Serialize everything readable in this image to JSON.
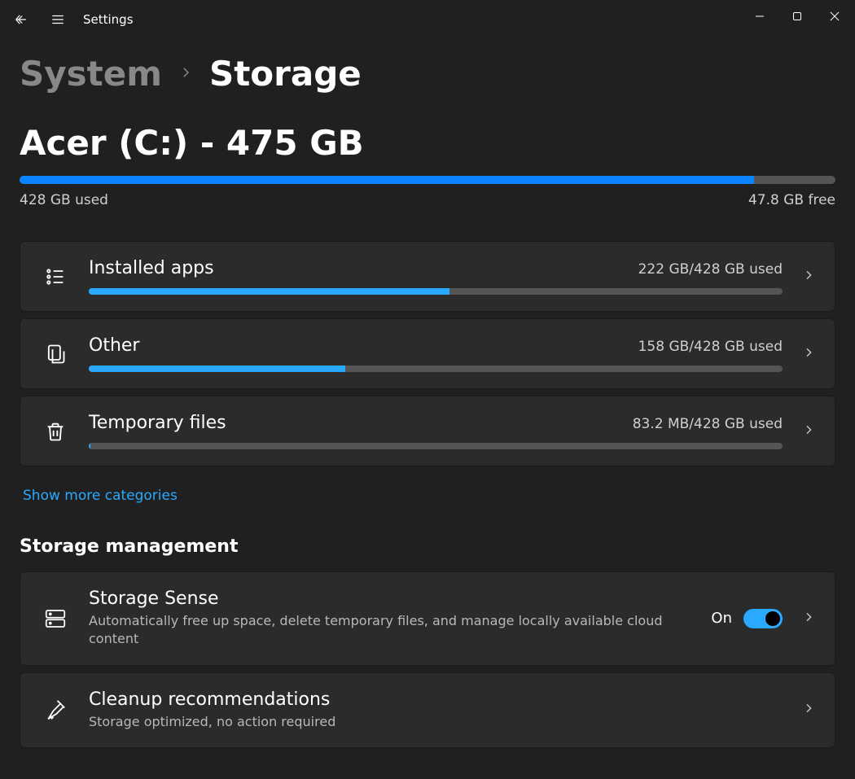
{
  "titlebar": {
    "app_name": "Settings"
  },
  "breadcrumb": {
    "parent": "System",
    "current": "Storage"
  },
  "drive": {
    "title": "Acer (C:) - 475 GB",
    "used_label": "428 GB used",
    "free_label": "47.8 GB free",
    "fill_percent": 90
  },
  "categories": [
    {
      "name": "Installed apps",
      "usage": "222 GB/428 GB used",
      "fill_percent": 52,
      "icon": "apps-list-icon"
    },
    {
      "name": "Other",
      "usage": "158 GB/428 GB used",
      "fill_percent": 37,
      "icon": "document-stack-icon"
    },
    {
      "name": "Temporary files",
      "usage": "83.2 MB/428 GB used",
      "fill_percent": 0.2,
      "icon": "trash-icon"
    }
  ],
  "show_more_label": "Show more categories",
  "storage_mgmt_heading": "Storage management",
  "storage_sense": {
    "title": "Storage Sense",
    "desc": "Automatically free up space, delete temporary files, and manage locally available cloud content",
    "toggle_label": "On",
    "toggle_on": true
  },
  "cleanup": {
    "title": "Cleanup recommendations",
    "desc": "Storage optimized, no action required"
  },
  "colors": {
    "accent": "#29a9ff"
  }
}
